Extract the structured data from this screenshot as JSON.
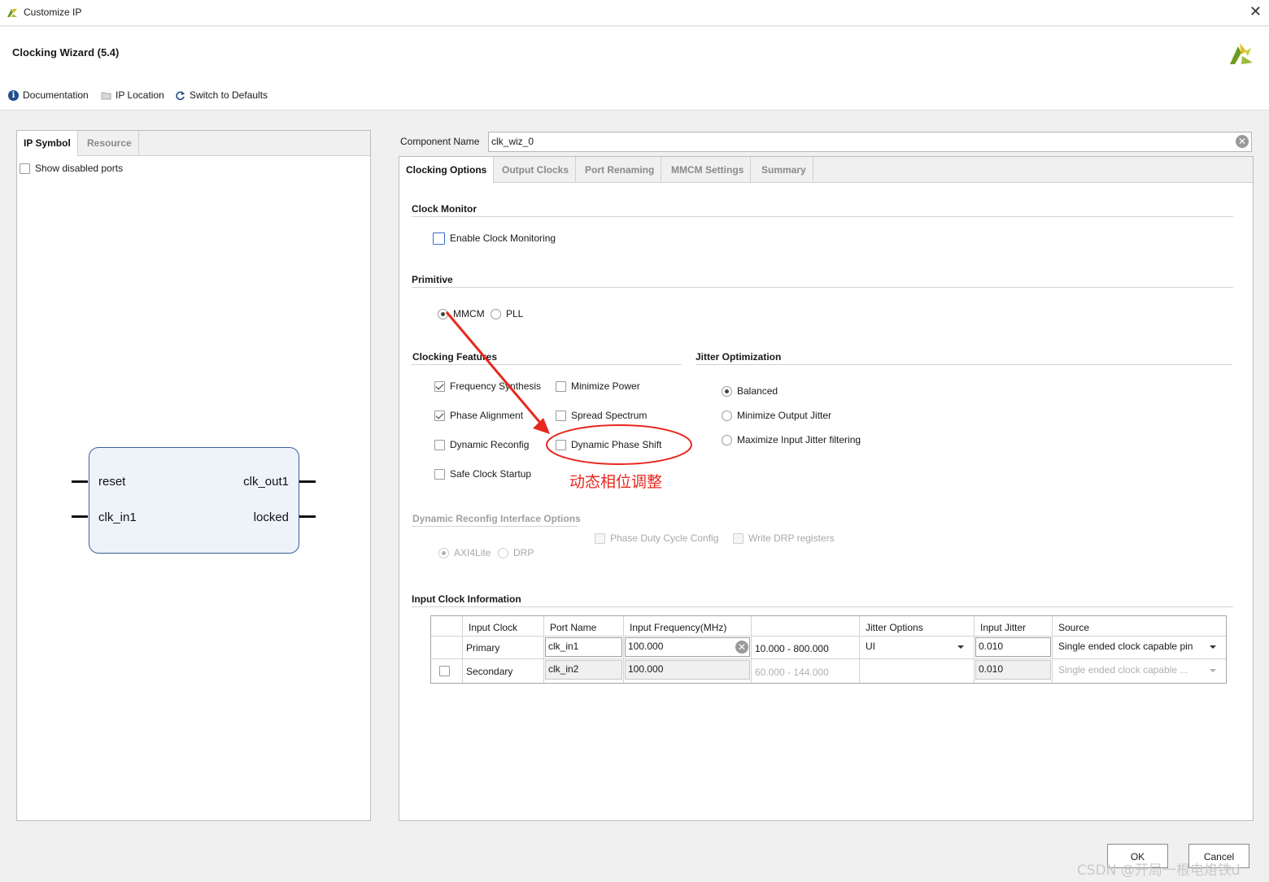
{
  "window": {
    "title": "Customize IP",
    "close_glyph": "✕"
  },
  "header": {
    "wizard_title": "Clocking Wizard (5.4)",
    "toolbar": [
      {
        "label": "Documentation",
        "icon": "info-icon"
      },
      {
        "label": "IP Location",
        "icon": "folder-icon"
      },
      {
        "label": "Switch to Defaults",
        "icon": "refresh-icon"
      }
    ]
  },
  "left_panel": {
    "tabs": [
      {
        "label": "IP Symbol",
        "active": true
      },
      {
        "label": "Resource",
        "active": false
      }
    ],
    "show_disabled_ports": {
      "label": "Show disabled ports",
      "checked": false
    },
    "symbol": {
      "left_ports": [
        "reset",
        "clk_in1"
      ],
      "right_ports": [
        "clk_out1",
        "locked"
      ]
    }
  },
  "right_panel": {
    "component_name_label": "Component Name",
    "component_name_value": "clk_wiz_0",
    "tabs": [
      {
        "label": "Clocking Options",
        "active": true
      },
      {
        "label": "Output Clocks",
        "active": false
      },
      {
        "label": "Port Renaming",
        "active": false
      },
      {
        "label": "MMCM Settings",
        "active": false
      },
      {
        "label": "Summary",
        "active": false
      }
    ],
    "clock_monitor": {
      "title": "Clock Monitor",
      "enable_clock_monitoring": {
        "label": "Enable Clock Monitoring",
        "checked": false
      }
    },
    "primitive": {
      "title": "Primitive",
      "options": [
        {
          "label": "MMCM",
          "selected": true
        },
        {
          "label": "PLL",
          "selected": false
        }
      ]
    },
    "clocking_features": {
      "title": "Clocking Features",
      "items": [
        {
          "label": "Frequency Synthesis",
          "checked": true
        },
        {
          "label": "Minimize Power",
          "checked": false
        },
        {
          "label": "Phase Alignment",
          "checked": true
        },
        {
          "label": "Spread Spectrum",
          "checked": false
        },
        {
          "label": "Dynamic Reconfig",
          "checked": false
        },
        {
          "label": "Dynamic Phase Shift",
          "checked": false
        },
        {
          "label": "Safe Clock Startup",
          "checked": false
        }
      ]
    },
    "jitter_optimization": {
      "title": "Jitter Optimization",
      "options": [
        {
          "label": "Balanced",
          "selected": true
        },
        {
          "label": "Minimize Output Jitter",
          "selected": false
        },
        {
          "label": "Maximize Input Jitter filtering",
          "selected": false
        }
      ]
    },
    "dynamic_reconfig": {
      "title": "Dynamic Reconfig Interface Options",
      "phase_duty_cycle_config": "Phase Duty Cycle Config",
      "write_drp_registers": "Write DRP registers",
      "interfaces": [
        {
          "label": "AXI4Lite",
          "selected": true
        },
        {
          "label": "DRP",
          "selected": false
        }
      ]
    },
    "input_clock_info": {
      "title": "Input Clock Information",
      "columns": [
        "Input Clock",
        "Port Name",
        "Input Frequency(MHz)",
        "",
        "Jitter Options",
        "Input Jitter",
        "Source"
      ],
      "rows": [
        {
          "input_clock": "Primary",
          "port_name": "clk_in1",
          "frequency": "100.000",
          "range": "10.000 - 800.000",
          "jitter_option": "UI",
          "input_jitter": "0.010",
          "source": "Single ended clock capable pin"
        },
        {
          "input_clock": "Secondary",
          "port_name": "clk_in2",
          "frequency": "100.000",
          "range": "60.000 - 144.000",
          "jitter_option": "",
          "input_jitter": "0.010",
          "source": "Single ended clock capable ..."
        }
      ]
    }
  },
  "annotation": {
    "text": "动态相位调整",
    "color": "#e8281e"
  },
  "footer": {
    "ok_label": "OK",
    "cancel_label": "Cancel"
  },
  "watermark": "CSDN @开局一根电烙铁d"
}
